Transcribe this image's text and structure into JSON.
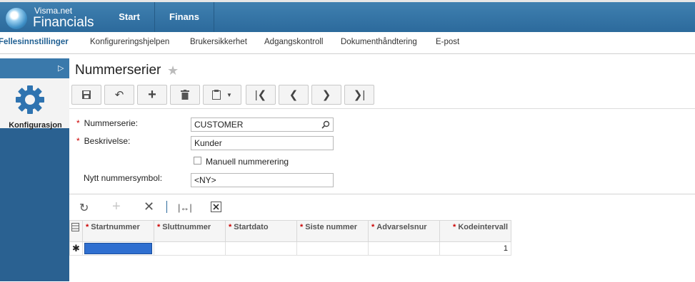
{
  "app": {
    "brand_small": "Visma.net",
    "brand_big": "Financials"
  },
  "topnav": {
    "start": "Start",
    "finans": "Finans"
  },
  "subnav": [
    "Fellesinnstillinger",
    "Konfigureringshjelpen",
    "Brukersikkerhet",
    "Adgangskontroll",
    "Dokumenthåndtering",
    "E-post"
  ],
  "sidebar": {
    "label": "Konfigurasjon"
  },
  "page": {
    "title": "Nummerserier"
  },
  "form": {
    "nummerserie_label": "Nummerserie:",
    "nummerserie_value": "CUSTOMER",
    "beskrivelse_label": "Beskrivelse:",
    "beskrivelse_value": "Kunder",
    "manuell_label": "Manuell nummerering",
    "nytt_label": "Nytt nummersymbol:",
    "nytt_value": "<NY>"
  },
  "grid": {
    "columns": [
      "Startnummer",
      "Sluttnummer",
      "Startdato",
      "Siste nummer",
      "Advarselsnur",
      "Kodeintervall"
    ],
    "row": {
      "kodeintervall": "1"
    }
  },
  "colors": {
    "topbar": "#2c6a9c",
    "sidebar": "#2a6191",
    "required": "#cc0000"
  }
}
